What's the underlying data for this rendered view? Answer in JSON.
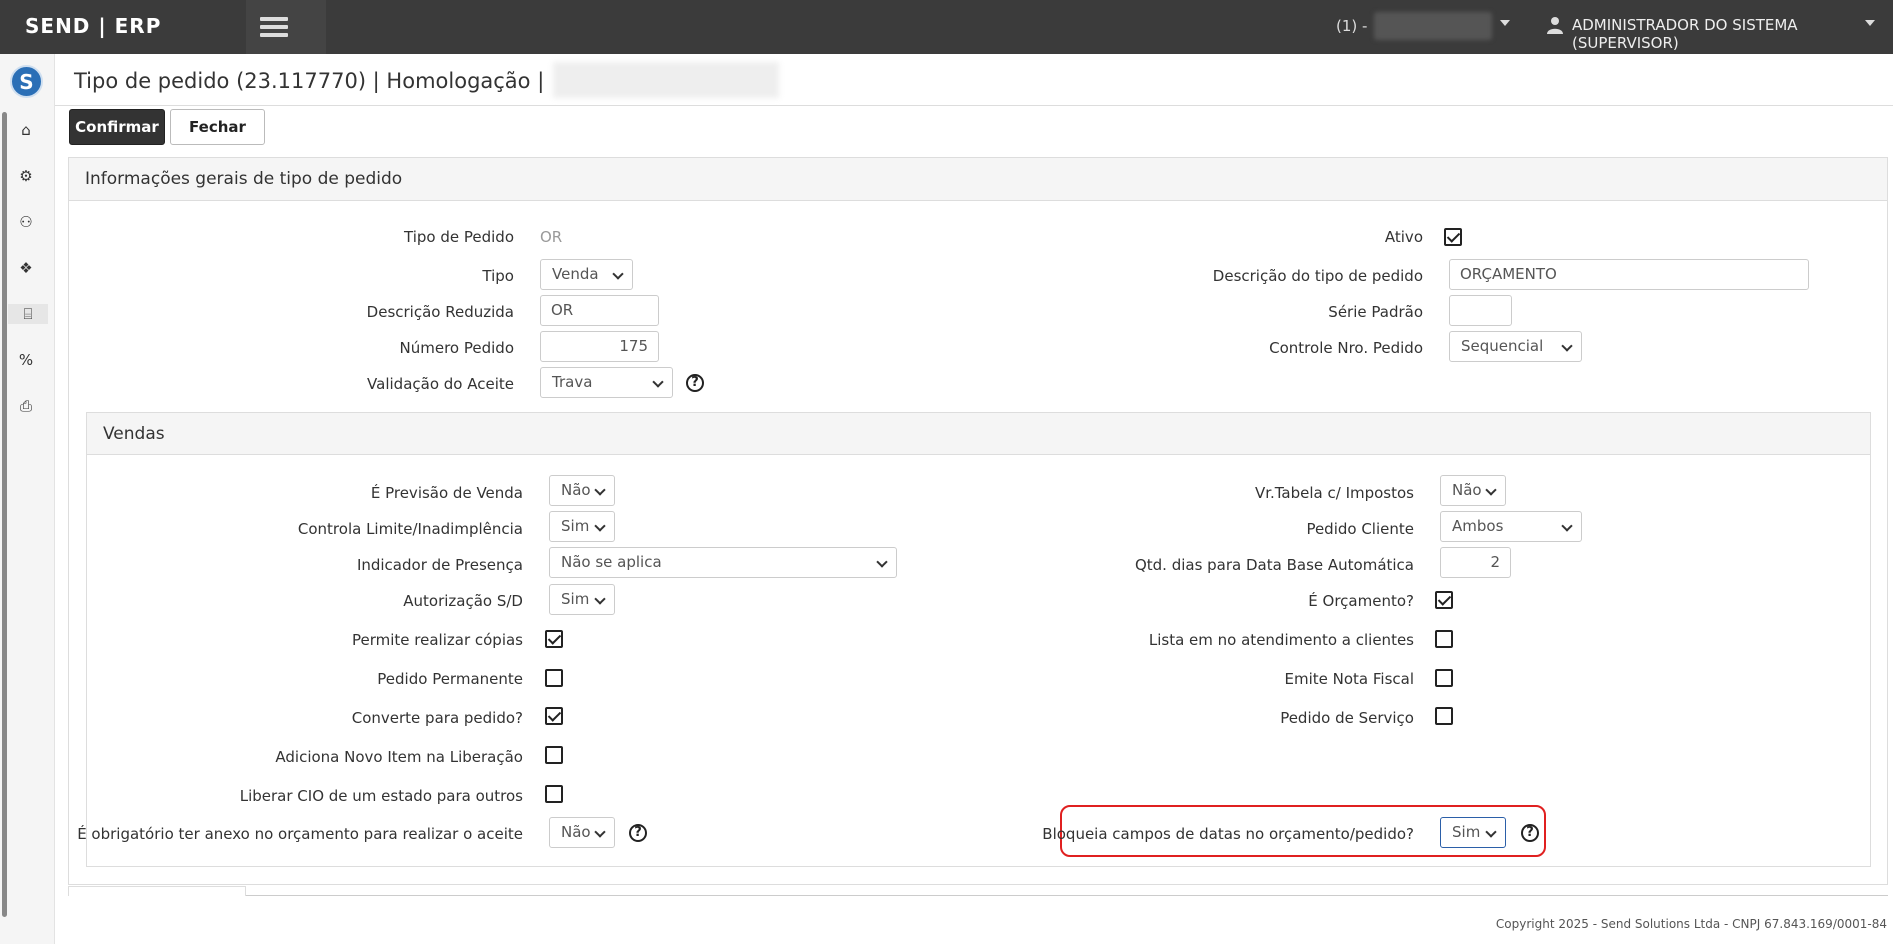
{
  "app": {
    "brand": "SEND | ERP"
  },
  "topbar": {
    "env_label": "(1) -",
    "user_label": "ADMINISTRADOR DO SISTEMA (SUPERVISOR)"
  },
  "sidebar": {
    "logo": "S",
    "items": [
      {
        "icon": "home-icon",
        "glyph": "⌂"
      },
      {
        "icon": "gears-icon",
        "glyph": "⚙"
      },
      {
        "icon": "handshake-icon",
        "glyph": "⚇"
      },
      {
        "icon": "cubes-icon",
        "glyph": "❖"
      },
      {
        "icon": "bank-icon",
        "glyph": "⌸"
      },
      {
        "icon": "percent-icon",
        "glyph": "%"
      },
      {
        "icon": "print-icon",
        "glyph": "⎙"
      }
    ]
  },
  "page": {
    "title": "Tipo de pedido (23.117770) | Homologação |"
  },
  "actions": {
    "confirm": "Confirmar",
    "close": "Fechar"
  },
  "general": {
    "heading": "Informações gerais de tipo de pedido",
    "tipo_pedido_label": "Tipo de Pedido",
    "tipo_pedido_value": "OR",
    "tipo_label": "Tipo",
    "tipo_value": "Venda",
    "desc_reduzida_label": "Descrição Reduzida",
    "desc_reduzida_value": "OR",
    "numero_label": "Número Pedido",
    "numero_value": "175",
    "validacao_label": "Validação do Aceite",
    "validacao_value": "Trava",
    "ativo_label": "Ativo",
    "ativo_checked": true,
    "descricao_label": "Descrição do tipo de pedido",
    "descricao_value": "ORÇAMENTO",
    "serie_label": "Série Padrão",
    "serie_value": "",
    "controle_label": "Controle Nro. Pedido",
    "controle_value": "Sequencial"
  },
  "vendas": {
    "heading": "Vendas",
    "previsao_label": "É Previsão de Venda",
    "previsao_value": "Não",
    "limite_label": "Controla Limite/Inadimplência",
    "limite_value": "Sim",
    "presenca_label": "Indicador de Presença",
    "presenca_value": "Não se aplica",
    "autorizacao_label": "Autorização S/D",
    "autorizacao_value": "Sim",
    "copias_label": "Permite realizar cópias",
    "copias_checked": true,
    "permanente_label": "Pedido Permanente",
    "permanente_checked": false,
    "converte_label": "Converte para pedido?",
    "converte_checked": true,
    "novo_item_label": "Adiciona Novo Item na Liberação",
    "novo_item_checked": false,
    "cio_label": "Liberar CIO de um estado para outros",
    "cio_checked": false,
    "anexo_label": "É obrigatório ter anexo no orçamento para realizar o aceite",
    "anexo_value": "Não",
    "vr_tabela_label": "Vr.Tabela c/ Impostos",
    "vr_tabela_value": "Não",
    "pedido_cliente_label": "Pedido Cliente",
    "pedido_cliente_value": "Ambos",
    "qtd_dias_label": "Qtd. dias para Data Base Automática",
    "qtd_dias_value": "2",
    "orcamento_label": "É Orçamento?",
    "orcamento_checked": true,
    "lista_label": "Lista em no atendimento a clientes",
    "lista_checked": false,
    "nota_label": "Emite Nota Fiscal",
    "nota_checked": false,
    "servico_label": "Pedido de Serviço",
    "servico_checked": false,
    "bloqueia_label": "Bloqueia campos de datas no orçamento/pedido?",
    "bloqueia_value": "Sim"
  },
  "help_glyph": "?",
  "footer": {
    "copyright": "Copyright 2025 - Send Solutions Ltda - CNPJ 67.843.169/0001-84"
  }
}
